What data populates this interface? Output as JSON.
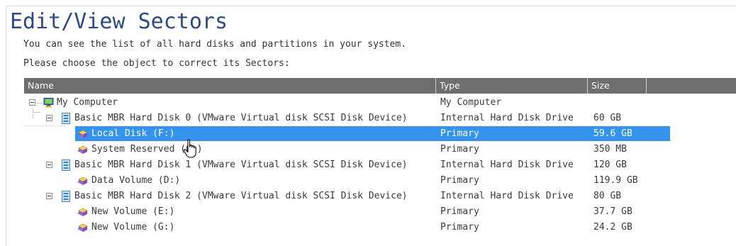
{
  "page": {
    "title": "Edit/View Sectors",
    "instruction_1": "You can see the list of all hard disks and partitions in your system.",
    "instruction_2": "Please choose the object to correct its Sectors:"
  },
  "table": {
    "columns": {
      "name": "Name",
      "type": "Type",
      "size": "Size"
    },
    "rows": [
      {
        "name": "My Computer",
        "type": "My Computer",
        "size": ""
      },
      {
        "name": "Basic MBR Hard Disk 0 (VMware Virtual disk SCSI Disk Device)",
        "type": "Internal Hard Disk Drive",
        "size": "60 GB"
      },
      {
        "name": "Local Disk (F:)",
        "type": "Primary",
        "size": "59.6 GB"
      },
      {
        "name": "System Reserved (C:)",
        "type": "Primary",
        "size": "350 MB"
      },
      {
        "name": "Basic MBR Hard Disk 1 (VMware Virtual disk SCSI Disk Device)",
        "type": "Internal Hard Disk Drive",
        "size": "120 GB"
      },
      {
        "name": "Data Volume (D:)",
        "type": "Primary",
        "size": "119.9 GB"
      },
      {
        "name": "Basic MBR Hard Disk 2 (VMware Virtual disk SCSI Disk Device)",
        "type": "Internal Hard Disk Drive",
        "size": "80 GB"
      },
      {
        "name": "New Volume (E:)",
        "type": "Primary",
        "size": "37.7 GB"
      },
      {
        "name": "New Volume (G:)",
        "type": "Primary",
        "size": "24.2 GB"
      }
    ]
  },
  "colors": {
    "title": "#2b4a8c",
    "header_bg": "#6e6e6e",
    "selection": "#3393ee"
  },
  "icons": {
    "computer": "computer-icon",
    "disk": "hard-disk-icon",
    "partition": "partition-icon",
    "cursor": "hand-cursor-icon"
  }
}
